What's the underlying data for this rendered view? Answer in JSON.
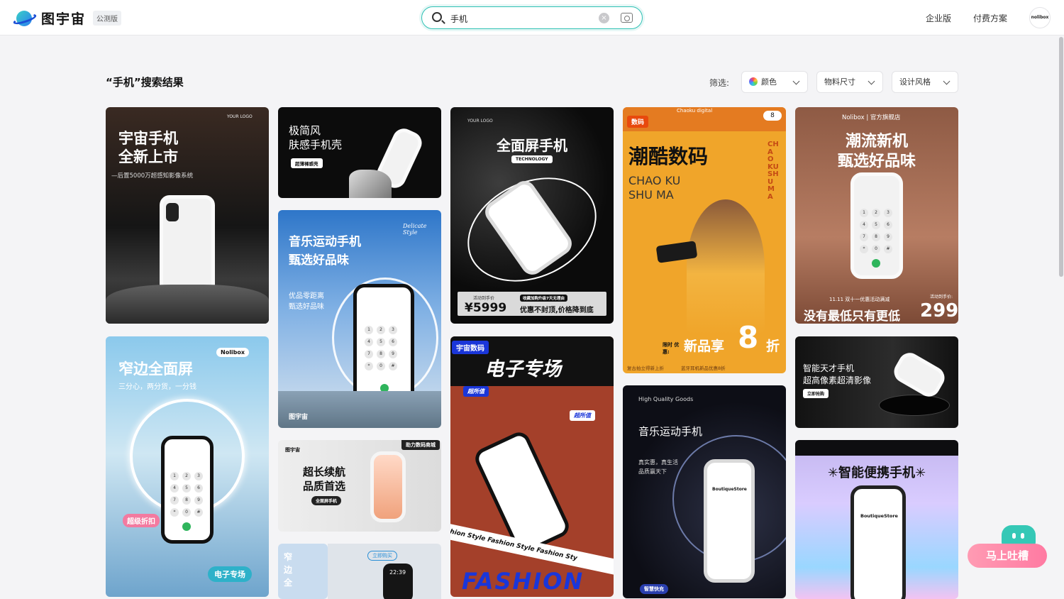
{
  "header": {
    "logo_text": "图宇宙",
    "beta_badge": "公测版",
    "search": {
      "value": "手机"
    },
    "links": [
      "企业版",
      "付费方案"
    ],
    "avatar_text": "nolibox"
  },
  "toolbar": {
    "result_title": "“手机”搜索结果",
    "filter_label": "筛选:",
    "filters": [
      "颜色",
      "物料尺寸",
      "设计风格"
    ]
  },
  "cards": {
    "c1": {
      "logo": "YOUR LOGO",
      "title1": "宇宙手机",
      "title2": "全新上市",
      "sub": "—后置5000万超感知影像系统"
    },
    "c2": {
      "title1": "极简风",
      "title2": "肤感手机壳",
      "tag": "超薄裸感壳"
    },
    "c3": {
      "logo": "YOUR LOGO",
      "title": "全面屏手机",
      "tag": "TECHNOLOGY",
      "price_label": "活动到手价",
      "price": "¥5999",
      "promo_small": "收藏加购升级7天无理由",
      "promo": "优惠不封顶,价格降到底"
    },
    "c4": {
      "badge": "数码",
      "marquee": "Chaoku digital",
      "count": "8",
      "title": "潮酷数码",
      "latin1": "CHAO KU",
      "latin2": "SHU MA",
      "side": "CHAO KU SHU MA",
      "limit": "限时 优惠:",
      "promo": "新品享",
      "big": "8",
      "unit": "折",
      "foot1": "复古拍立得新上折",
      "foot2": "蓝牙耳机新品优惠8折"
    },
    "c5": {
      "brand": "Nolibox | 官方旗舰店",
      "title1": "潮流新机",
      "title2": "甄选好品味",
      "event": "11.11 双十一优惠活动满减",
      "slogan": "没有最低只有更低",
      "price_label": "活动到手价:",
      "price": "299"
    },
    "c6": {
      "title1": "音乐运动手机",
      "title2": "甄选好品味",
      "script": "Delicate Style",
      "sub1": "优品零距离",
      "sub2": "甄选好品味",
      "brand": "图宇宙"
    },
    "c7": {
      "brand": "Nolibox",
      "title": "窄边全面屏",
      "sub": "三分心，两分货，一分钱",
      "tag": "超级折扣",
      "btn": "电子专场"
    },
    "c8": {
      "badge": "宇宙数码",
      "title": "电子专场",
      "tag1": "超所值",
      "tag2": "超所值",
      "band": "Fashion Style  Fashion Style  Fashion Sty",
      "big": "FASHION"
    },
    "c9": {
      "title1": "智能天才手机",
      "title2": "超高像素超清影像",
      "btn": "立即抢购"
    },
    "c10": {
      "brand": "图宇宙",
      "ribbon": "助力数码商城",
      "title1": "超长续航",
      "title2": "品质首选",
      "btn": "全面屏手机"
    },
    "c11": {
      "small": "High Quality Goods",
      "title": "音乐运动手机",
      "sub1": "真实惠，真生活",
      "sub2": "品质赢天下",
      "store": "BoutiqueStore",
      "tag": "智慧快充"
    },
    "c12": {
      "title": "✳智能便携手机✳",
      "store": "BoutiqueStore"
    },
    "c13": {
      "text": "窄边全"
    },
    "c14": {
      "tag": "立即购买",
      "time": "22:39"
    }
  },
  "feedback": {
    "label": "马上吐槽"
  },
  "colors": {
    "accent": "#2fc1b4",
    "feedback": "#ff7aa2"
  }
}
